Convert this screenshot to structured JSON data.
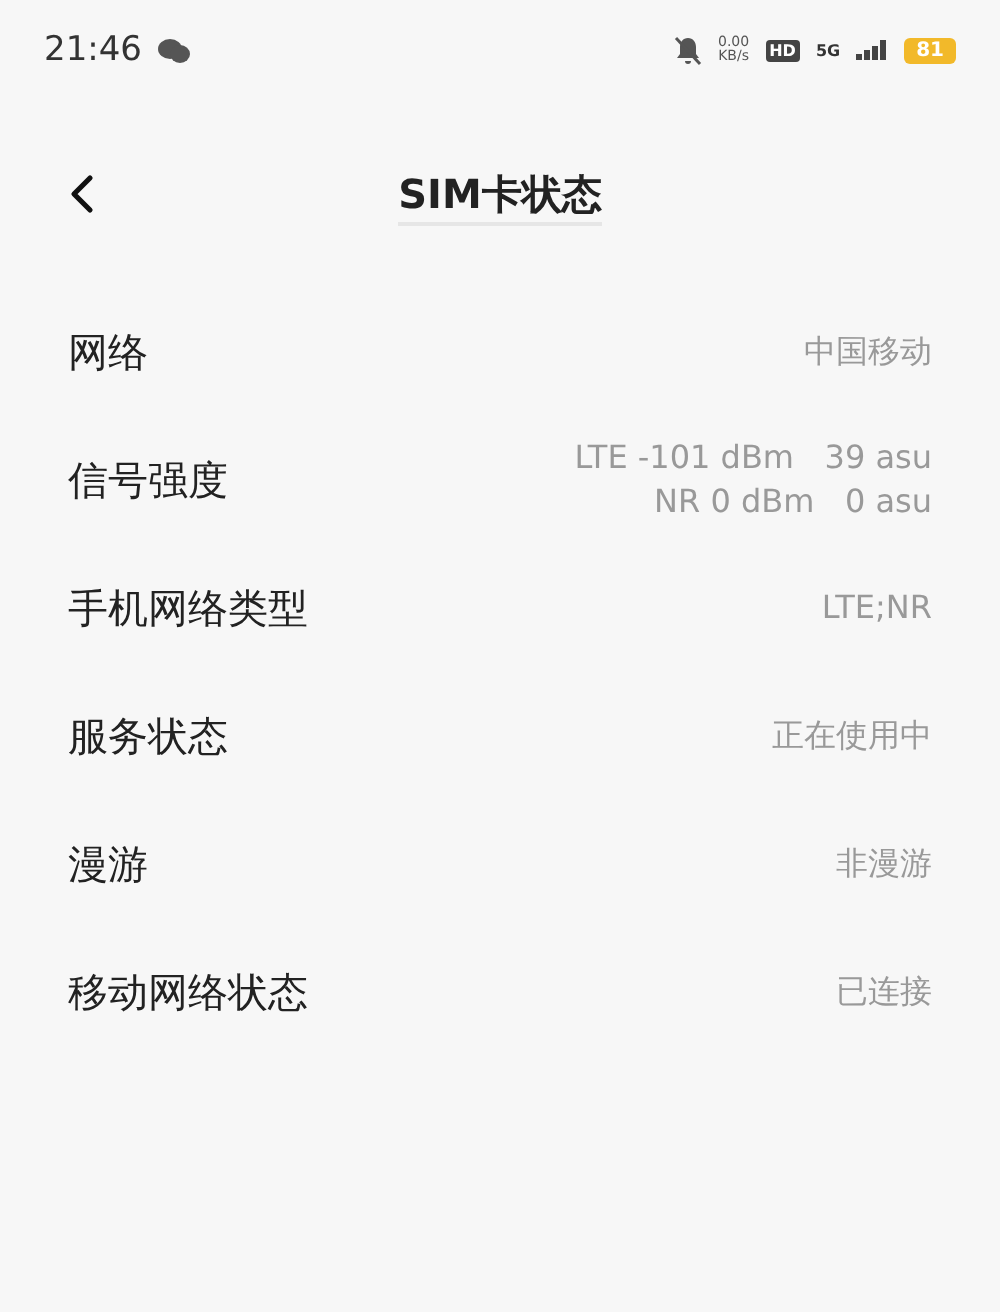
{
  "status_bar": {
    "time": "21:46",
    "net_speed": "0.00",
    "net_speed_unit": "KB/s",
    "hd": "HD",
    "network": "5G",
    "battery": "81"
  },
  "header": {
    "title": "SIM卡状态"
  },
  "rows": [
    {
      "label": "网络",
      "values": [
        "中国移动"
      ]
    },
    {
      "label": "信号强度",
      "values": [
        "LTE -101 dBm   39 asu",
        "NR 0 dBm   0 asu"
      ]
    },
    {
      "label": "手机网络类型",
      "values": [
        "LTE;NR"
      ]
    },
    {
      "label": "服务状态",
      "values": [
        "正在使用中"
      ]
    },
    {
      "label": "漫游",
      "values": [
        "非漫游"
      ]
    },
    {
      "label": "移动网络状态",
      "values": [
        "已连接"
      ]
    }
  ]
}
